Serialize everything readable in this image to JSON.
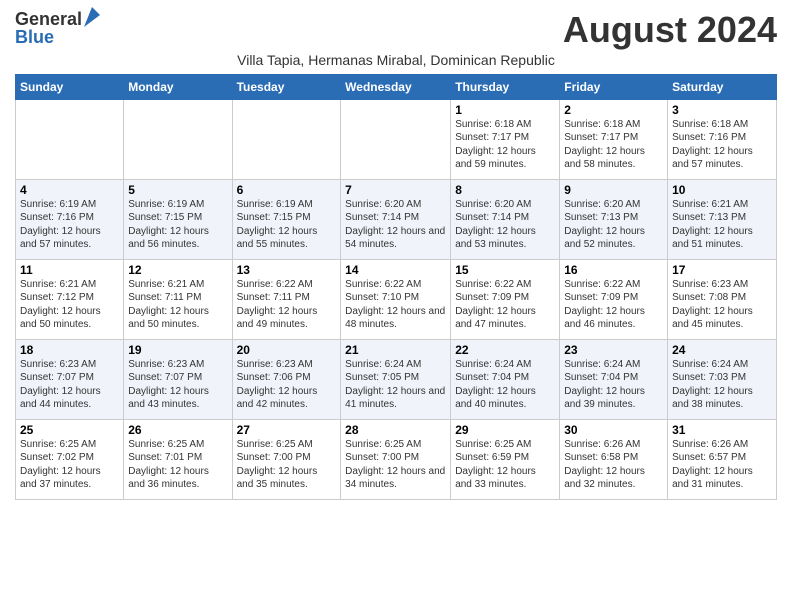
{
  "header": {
    "logo_general": "General",
    "logo_blue": "Blue",
    "month_year": "August 2024",
    "location": "Villa Tapia, Hermanas Mirabal, Dominican Republic"
  },
  "weekdays": [
    "Sunday",
    "Monday",
    "Tuesday",
    "Wednesday",
    "Thursday",
    "Friday",
    "Saturday"
  ],
  "weeks": [
    [
      {
        "day": "",
        "sunrise": "",
        "sunset": "",
        "daylight": ""
      },
      {
        "day": "",
        "sunrise": "",
        "sunset": "",
        "daylight": ""
      },
      {
        "day": "",
        "sunrise": "",
        "sunset": "",
        "daylight": ""
      },
      {
        "day": "",
        "sunrise": "",
        "sunset": "",
        "daylight": ""
      },
      {
        "day": "1",
        "sunrise": "Sunrise: 6:18 AM",
        "sunset": "Sunset: 7:17 PM",
        "daylight": "Daylight: 12 hours and 59 minutes."
      },
      {
        "day": "2",
        "sunrise": "Sunrise: 6:18 AM",
        "sunset": "Sunset: 7:17 PM",
        "daylight": "Daylight: 12 hours and 58 minutes."
      },
      {
        "day": "3",
        "sunrise": "Sunrise: 6:18 AM",
        "sunset": "Sunset: 7:16 PM",
        "daylight": "Daylight: 12 hours and 57 minutes."
      }
    ],
    [
      {
        "day": "4",
        "sunrise": "Sunrise: 6:19 AM",
        "sunset": "Sunset: 7:16 PM",
        "daylight": "Daylight: 12 hours and 57 minutes."
      },
      {
        "day": "5",
        "sunrise": "Sunrise: 6:19 AM",
        "sunset": "Sunset: 7:15 PM",
        "daylight": "Daylight: 12 hours and 56 minutes."
      },
      {
        "day": "6",
        "sunrise": "Sunrise: 6:19 AM",
        "sunset": "Sunset: 7:15 PM",
        "daylight": "Daylight: 12 hours and 55 minutes."
      },
      {
        "day": "7",
        "sunrise": "Sunrise: 6:20 AM",
        "sunset": "Sunset: 7:14 PM",
        "daylight": "Daylight: 12 hours and 54 minutes."
      },
      {
        "day": "8",
        "sunrise": "Sunrise: 6:20 AM",
        "sunset": "Sunset: 7:14 PM",
        "daylight": "Daylight: 12 hours and 53 minutes."
      },
      {
        "day": "9",
        "sunrise": "Sunrise: 6:20 AM",
        "sunset": "Sunset: 7:13 PM",
        "daylight": "Daylight: 12 hours and 52 minutes."
      },
      {
        "day": "10",
        "sunrise": "Sunrise: 6:21 AM",
        "sunset": "Sunset: 7:13 PM",
        "daylight": "Daylight: 12 hours and 51 minutes."
      }
    ],
    [
      {
        "day": "11",
        "sunrise": "Sunrise: 6:21 AM",
        "sunset": "Sunset: 7:12 PM",
        "daylight": "Daylight: 12 hours and 50 minutes."
      },
      {
        "day": "12",
        "sunrise": "Sunrise: 6:21 AM",
        "sunset": "Sunset: 7:11 PM",
        "daylight": "Daylight: 12 hours and 50 minutes."
      },
      {
        "day": "13",
        "sunrise": "Sunrise: 6:22 AM",
        "sunset": "Sunset: 7:11 PM",
        "daylight": "Daylight: 12 hours and 49 minutes."
      },
      {
        "day": "14",
        "sunrise": "Sunrise: 6:22 AM",
        "sunset": "Sunset: 7:10 PM",
        "daylight": "Daylight: 12 hours and 48 minutes."
      },
      {
        "day": "15",
        "sunrise": "Sunrise: 6:22 AM",
        "sunset": "Sunset: 7:09 PM",
        "daylight": "Daylight: 12 hours and 47 minutes."
      },
      {
        "day": "16",
        "sunrise": "Sunrise: 6:22 AM",
        "sunset": "Sunset: 7:09 PM",
        "daylight": "Daylight: 12 hours and 46 minutes."
      },
      {
        "day": "17",
        "sunrise": "Sunrise: 6:23 AM",
        "sunset": "Sunset: 7:08 PM",
        "daylight": "Daylight: 12 hours and 45 minutes."
      }
    ],
    [
      {
        "day": "18",
        "sunrise": "Sunrise: 6:23 AM",
        "sunset": "Sunset: 7:07 PM",
        "daylight": "Daylight: 12 hours and 44 minutes."
      },
      {
        "day": "19",
        "sunrise": "Sunrise: 6:23 AM",
        "sunset": "Sunset: 7:07 PM",
        "daylight": "Daylight: 12 hours and 43 minutes."
      },
      {
        "day": "20",
        "sunrise": "Sunrise: 6:23 AM",
        "sunset": "Sunset: 7:06 PM",
        "daylight": "Daylight: 12 hours and 42 minutes."
      },
      {
        "day": "21",
        "sunrise": "Sunrise: 6:24 AM",
        "sunset": "Sunset: 7:05 PM",
        "daylight": "Daylight: 12 hours and 41 minutes."
      },
      {
        "day": "22",
        "sunrise": "Sunrise: 6:24 AM",
        "sunset": "Sunset: 7:04 PM",
        "daylight": "Daylight: 12 hours and 40 minutes."
      },
      {
        "day": "23",
        "sunrise": "Sunrise: 6:24 AM",
        "sunset": "Sunset: 7:04 PM",
        "daylight": "Daylight: 12 hours and 39 minutes."
      },
      {
        "day": "24",
        "sunrise": "Sunrise: 6:24 AM",
        "sunset": "Sunset: 7:03 PM",
        "daylight": "Daylight: 12 hours and 38 minutes."
      }
    ],
    [
      {
        "day": "25",
        "sunrise": "Sunrise: 6:25 AM",
        "sunset": "Sunset: 7:02 PM",
        "daylight": "Daylight: 12 hours and 37 minutes."
      },
      {
        "day": "26",
        "sunrise": "Sunrise: 6:25 AM",
        "sunset": "Sunset: 7:01 PM",
        "daylight": "Daylight: 12 hours and 36 minutes."
      },
      {
        "day": "27",
        "sunrise": "Sunrise: 6:25 AM",
        "sunset": "Sunset: 7:00 PM",
        "daylight": "Daylight: 12 hours and 35 minutes."
      },
      {
        "day": "28",
        "sunrise": "Sunrise: 6:25 AM",
        "sunset": "Sunset: 7:00 PM",
        "daylight": "Daylight: 12 hours and 34 minutes."
      },
      {
        "day": "29",
        "sunrise": "Sunrise: 6:25 AM",
        "sunset": "Sunset: 6:59 PM",
        "daylight": "Daylight: 12 hours and 33 minutes."
      },
      {
        "day": "30",
        "sunrise": "Sunrise: 6:26 AM",
        "sunset": "Sunset: 6:58 PM",
        "daylight": "Daylight: 12 hours and 32 minutes."
      },
      {
        "day": "31",
        "sunrise": "Sunrise: 6:26 AM",
        "sunset": "Sunset: 6:57 PM",
        "daylight": "Daylight: 12 hours and 31 minutes."
      }
    ]
  ]
}
